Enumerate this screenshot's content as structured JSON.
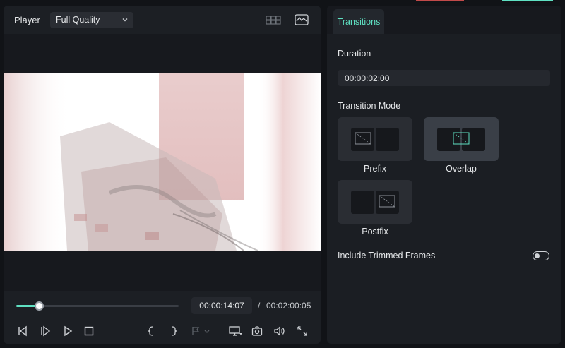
{
  "player": {
    "title": "Player",
    "quality": "Full Quality",
    "current_time": "00:00:14:07",
    "time_separator": "/",
    "total_time": "00:02:00:05",
    "progress": 0.14
  },
  "transitions": {
    "tab_label": "Transitions",
    "duration_label": "Duration",
    "duration_value": "00:00:02:00",
    "mode_label": "Transition Mode",
    "modes": [
      {
        "label": "Prefix"
      },
      {
        "label": "Overlap"
      },
      {
        "label": "Postfix"
      }
    ],
    "selected_mode": "Overlap",
    "include_trimmed_label": "Include Trimmed Frames",
    "include_trimmed_on": false
  },
  "colors": {
    "accent": "#5fe0c2",
    "background": "#111317",
    "panel": "#1b1e23"
  },
  "icons": {
    "header": [
      "grid-view-icon",
      "waveform-scope-icon"
    ],
    "controls": [
      "previous-frame-icon",
      "next-frame-icon",
      "play-icon",
      "stop-icon",
      "mark-in-icon",
      "mark-out-icon",
      "marker-icon",
      "display-icon",
      "snapshot-icon",
      "volume-icon",
      "fullscreen-icon"
    ]
  }
}
